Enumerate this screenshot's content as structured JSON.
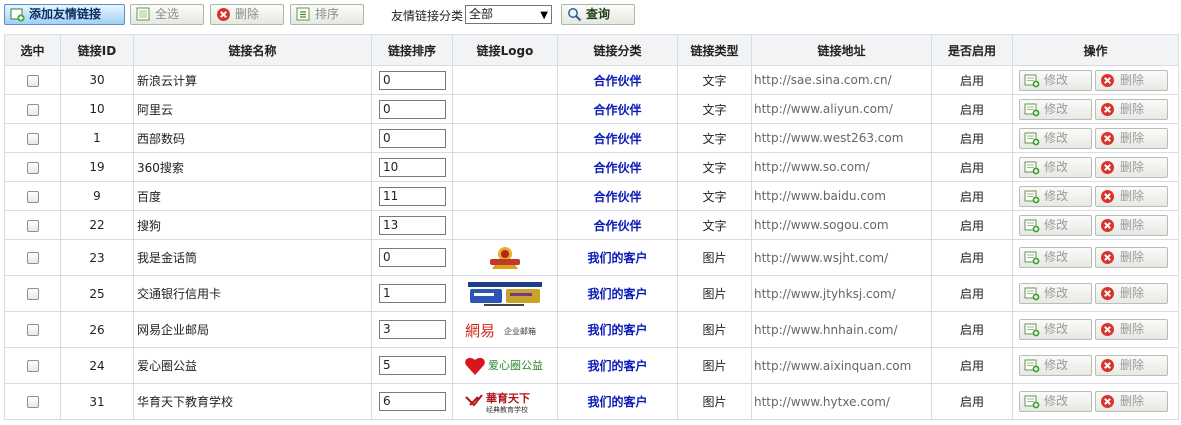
{
  "toolbar": {
    "add_label": "添加友情链接",
    "select_all_label": "全选",
    "delete_label": "删除",
    "sort_label": "排序",
    "category_label": "友情链接分类",
    "category_selected": "全部",
    "query_label": "查询"
  },
  "table": {
    "headers": {
      "select": "选中",
      "id": "链接ID",
      "name": "链接名称",
      "sort": "链接排序",
      "logo": "链接Logo",
      "category": "链接分类",
      "type": "链接类型",
      "url": "链接地址",
      "enabled": "是否启用",
      "ops": "操作"
    },
    "edit_label": "修改",
    "delete_label": "删除",
    "rows": [
      {
        "id": "30",
        "name": "新浪云计算",
        "sort": "0",
        "logo": "",
        "category": "合作伙伴",
        "type": "文字",
        "url": "http://sae.sina.com.cn/",
        "enabled": "启用"
      },
      {
        "id": "10",
        "name": "阿里云",
        "sort": "0",
        "logo": "",
        "category": "合作伙伴",
        "type": "文字",
        "url": "http://www.aliyun.com/",
        "enabled": "启用"
      },
      {
        "id": "1",
        "name": "西部数码",
        "sort": "0",
        "logo": "",
        "category": "合作伙伴",
        "type": "文字",
        "url": "http://www.west263.com",
        "enabled": "启用"
      },
      {
        "id": "19",
        "name": "360搜索",
        "sort": "10",
        "logo": "",
        "category": "合作伙伴",
        "type": "文字",
        "url": "http://www.so.com/",
        "enabled": "启用"
      },
      {
        "id": "9",
        "name": "百度",
        "sort": "11",
        "logo": "",
        "category": "合作伙伴",
        "type": "文字",
        "url": "http://www.baidu.com",
        "enabled": "启用"
      },
      {
        "id": "22",
        "name": "搜狗",
        "sort": "13",
        "logo": "",
        "category": "合作伙伴",
        "type": "文字",
        "url": "http://www.sogou.com",
        "enabled": "启用"
      },
      {
        "id": "23",
        "name": "我是金话筒",
        "sort": "0",
        "logo": "jinhuatong-logo",
        "category": "我们的客户",
        "type": "图片",
        "url": "http://www.wsjht.com/",
        "enabled": "启用"
      },
      {
        "id": "25",
        "name": "交通银行信用卡",
        "sort": "1",
        "logo": "bankcomm-card-logo",
        "category": "我们的客户",
        "type": "图片",
        "url": "http://www.jtyhksj.com/",
        "enabled": "启用"
      },
      {
        "id": "26",
        "name": "网易企业邮局",
        "sort": "3",
        "logo": "netease-mail-logo",
        "category": "我们的客户",
        "type": "图片",
        "url": "http://www.hnhain.com/",
        "enabled": "启用"
      },
      {
        "id": "24",
        "name": "爱心圈公益",
        "sort": "5",
        "logo": "aixinquan-logo",
        "category": "我们的客户",
        "type": "图片",
        "url": "http://www.aixinquan.com",
        "enabled": "启用"
      },
      {
        "id": "31",
        "name": "华育天下教育学校",
        "sort": "6",
        "logo": "huayutianxia-logo",
        "category": "我们的客户",
        "type": "图片",
        "url": "http://www.hytxe.com/",
        "enabled": "启用"
      }
    ]
  },
  "logos": {
    "netease_text": "網易",
    "netease_sub": "企业邮箱",
    "aixin_text": "爱心圈公益",
    "huayu_text": "華育天下",
    "huayu_sub": "经典教育学校"
  },
  "colors": {
    "category_text": "#0a1ab8",
    "primary_button": "#9fd1f6",
    "header_bg": "#f1f3f5"
  }
}
